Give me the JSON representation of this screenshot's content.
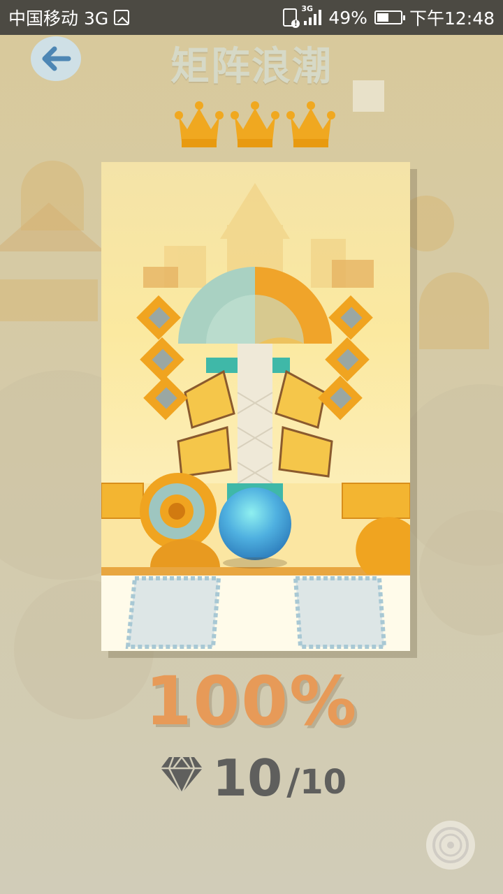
{
  "status_bar": {
    "carrier": "中国移动 3G",
    "network_tag": "3G",
    "battery": "49%",
    "battery_level": 0.49,
    "time": "下午12:48"
  },
  "header": {
    "back_icon": "back-arrow-icon",
    "title": "矩阵浪潮"
  },
  "crowns": {
    "earned": 3,
    "total": 3,
    "color": "#f0a820"
  },
  "result": {
    "percent": "100%",
    "gems_collected": "10",
    "gems_separator": "/",
    "gems_total": "10"
  },
  "colors": {
    "percent": "#e79a58",
    "ball": "#4fb0e0",
    "teal_tile": "#3fb8a8",
    "gold": "#f0a820"
  },
  "footer": {
    "disc_icon": "music-disc-icon"
  }
}
